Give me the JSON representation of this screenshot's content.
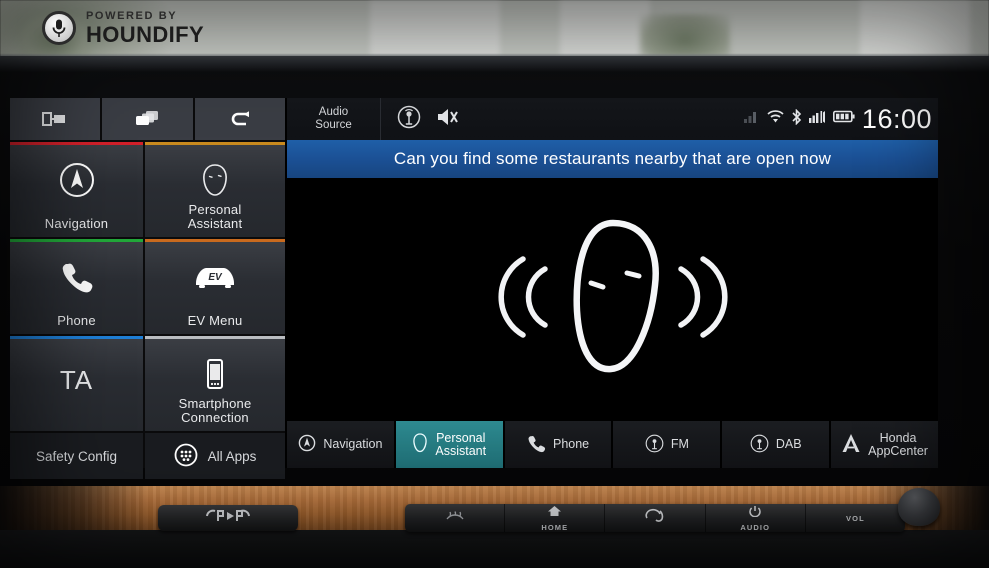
{
  "badge": {
    "powered_by": "POWERED BY",
    "brand": "HOUNDIFY",
    "mic_icon": "microphone-icon"
  },
  "head_unit": {
    "top_icons": [
      {
        "name": "display-off-icon",
        "label": "Display Off"
      },
      {
        "name": "card-stack-icon",
        "label": "Cards"
      },
      {
        "name": "back-arrow-icon",
        "label": "Back"
      }
    ],
    "menu_tiles": [
      {
        "label": "Navigation",
        "icon": "compass-icon",
        "accent": "#d3202a"
      },
      {
        "label": "Personal\nAssistant",
        "label_line1": "Personal",
        "label_line2": "Assistant",
        "icon": "head-outline-icon",
        "accent": "#c98a1e"
      },
      {
        "label": "Phone",
        "icon": "phone-handset-icon",
        "accent": "#22a83a"
      },
      {
        "label": "EV Menu",
        "icon": "ev-car-icon",
        "accent": "#c96a1e"
      },
      {
        "label": "TA",
        "icon": "text-ta",
        "accent": "#1f7fd6"
      },
      {
        "label": "Smartphone\nConnection",
        "label_line1": "Smartphone",
        "label_line2": "Connection",
        "icon": "smartphone-icon",
        "accent": "#b9bcc0"
      }
    ],
    "bottom_tiles": [
      {
        "label": "Safety Config",
        "icon": "none"
      },
      {
        "label": "All Apps",
        "icon": "apps-grid-icon"
      }
    ],
    "status_bar": {
      "audio_source_line1": "Audio",
      "audio_source_line2": "Source",
      "icons": [
        {
          "name": "radio-antenna-icon"
        },
        {
          "name": "speaker-muted-icon"
        }
      ],
      "indicators": [
        {
          "name": "signal-bars-dim-icon"
        },
        {
          "name": "wifi-icon"
        },
        {
          "name": "bluetooth-icon"
        },
        {
          "name": "cellular-signal-icon"
        },
        {
          "name": "battery-icon"
        }
      ],
      "clock": "16:00"
    },
    "banner": {
      "text": "Can you find some restaurants nearby that are open now",
      "color": "#1b5095"
    },
    "stage": {
      "graphic": "listening-head-with-sound-waves"
    },
    "tabs": [
      {
        "label": "Navigation",
        "icon": "compass-icon",
        "active": false
      },
      {
        "label_line1": "Personal",
        "label_line2": "Assistant",
        "icon": "head-outline-icon",
        "active": true
      },
      {
        "label": "Phone",
        "icon": "phone-handset-icon",
        "active": false
      },
      {
        "label": "FM",
        "icon": "radio-antenna-icon",
        "active": false
      },
      {
        "label": "DAB",
        "icon": "radio-antenna-icon",
        "active": false
      },
      {
        "label_line1": "Honda",
        "label_line2": "AppCenter",
        "icon": "honda-a-icon",
        "active": false
      }
    ],
    "accent_active": "#2e8a90"
  },
  "physical_controls": {
    "park_button": {
      "label": "P",
      "icon": "parking-sensor-icon"
    },
    "strip": [
      {
        "label": "",
        "icon": "defrost-icon"
      },
      {
        "label": "HOME",
        "icon": "home-icon"
      },
      {
        "label": "",
        "icon": "call-icon"
      },
      {
        "label": "AUDIO",
        "icon": "power-icon"
      },
      {
        "label": "VOL",
        "icon": "none"
      }
    ],
    "knob": {
      "name": "volume-knob"
    }
  }
}
